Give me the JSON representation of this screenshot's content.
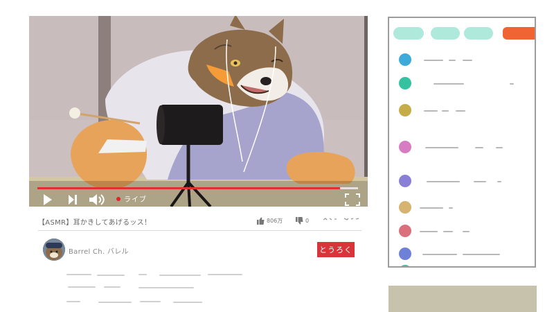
{
  "video": {
    "title": "【ASMR】耳かきしてあげるッス！",
    "live_label": "ライブ",
    "progress": 0.944,
    "likes": "806万",
    "dislikes": "0"
  },
  "channel": {
    "name": "Barrel Ch. バレル",
    "subscribe_label": "とうろく"
  },
  "colors": {
    "accent_red": "#e0312f",
    "subscribe_red": "#d8343a",
    "chat_tabs": [
      "#aee9dc",
      "#aee9dc",
      "#aee9dc",
      "#ef6432"
    ],
    "chat_avatars": [
      "#3eaad9",
      "#36c2a0",
      "#c4ad48",
      "#d77cc3",
      "#8a7fd6",
      "#d6b36f",
      "#d9707c",
      "#6f80d8",
      "#36c2a0"
    ],
    "ad_box": "#c7c2ac"
  },
  "chat": {
    "tabs": [
      "tab-1",
      "tab-2",
      "tab-3",
      "tab-live"
    ],
    "messages": [
      {
        "avatar_color": "#3eaad9"
      },
      {
        "avatar_color": "#36c2a0"
      },
      {
        "avatar_color": "#c4ad48"
      },
      {
        "avatar_color": "#d77cc3"
      },
      {
        "avatar_color": "#8a7fd6"
      },
      {
        "avatar_color": "#d6b36f"
      },
      {
        "avatar_color": "#d9707c"
      },
      {
        "avatar_color": "#6f80d8"
      },
      {
        "avatar_color": "#36c2a0"
      }
    ]
  },
  "icons": {
    "play": "play-icon",
    "next": "skip-next-icon",
    "volume": "volume-icon",
    "fullscreen": "fullscreen-icon",
    "like": "thumbs-up-icon",
    "dislike": "thumbs-down-icon"
  }
}
